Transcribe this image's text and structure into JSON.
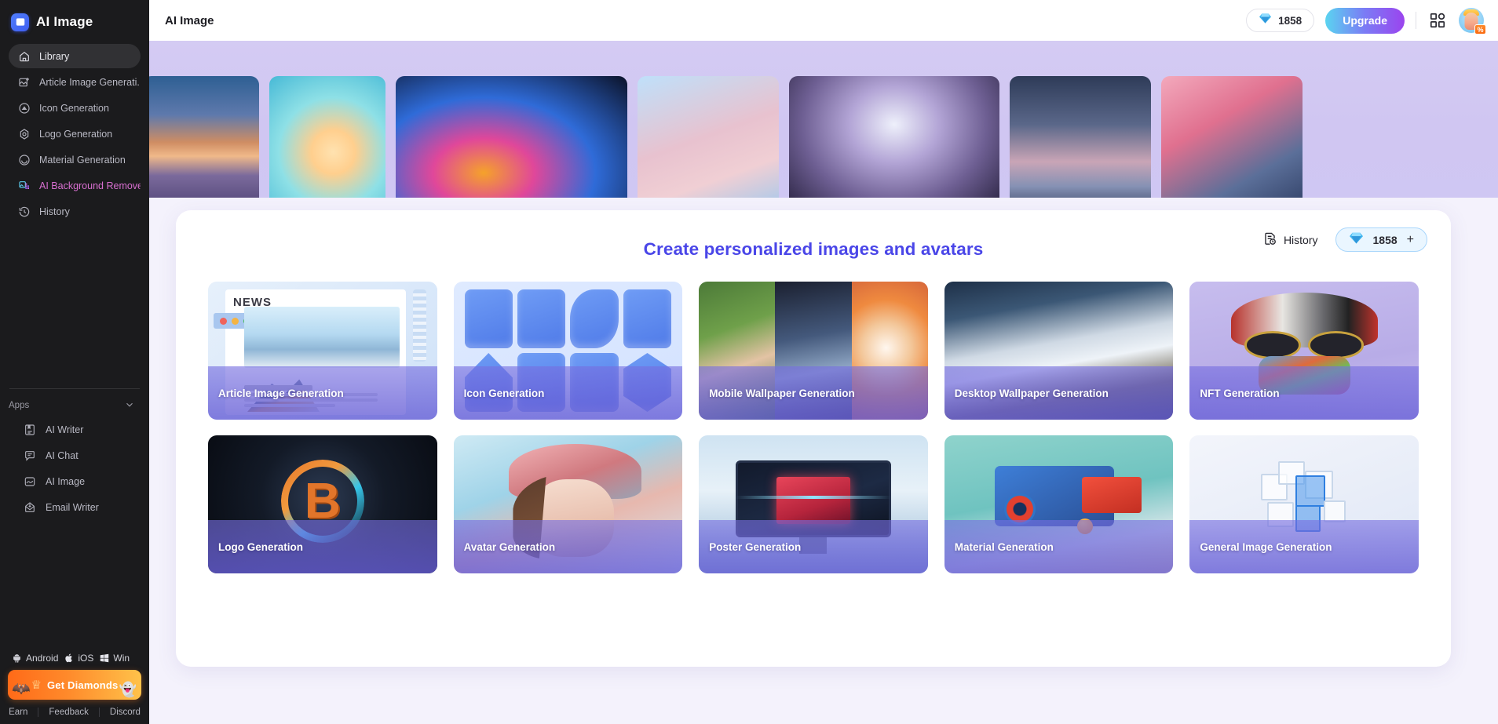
{
  "sidebar": {
    "brand": {
      "name": "AI Image",
      "logo_icon": "ai-image-logo-icon"
    },
    "items": [
      {
        "label": "Library",
        "icon": "home-icon",
        "active": true
      },
      {
        "label": "Article Image Generati...",
        "icon": "image-plus-icon",
        "active": false
      },
      {
        "label": "Icon Generation",
        "icon": "icon-generation-icon",
        "active": false
      },
      {
        "label": "Logo Generation",
        "icon": "logo-generation-icon",
        "active": false
      },
      {
        "label": "Material Generation",
        "icon": "material-generation-icon",
        "active": false
      },
      {
        "label": "AI Background Remove",
        "icon": "background-remove-icon",
        "active": false,
        "accent": true
      },
      {
        "label": "History",
        "icon": "history-clock-icon",
        "active": false
      }
    ],
    "apps_section": {
      "label": "Apps",
      "collapse_icon": "chevron-down-icon"
    },
    "apps": [
      {
        "label": "AI Writer",
        "icon": "ai-writer-icon"
      },
      {
        "label": "AI Chat",
        "icon": "ai-chat-icon"
      },
      {
        "label": "AI Image",
        "icon": "ai-image-icon"
      },
      {
        "label": "Email Writer",
        "icon": "email-writer-icon"
      }
    ],
    "platforms": [
      {
        "label": "Android",
        "icon": "android-icon"
      },
      {
        "label": "iOS",
        "icon": "apple-icon"
      },
      {
        "label": "Win",
        "icon": "windows-icon"
      }
    ],
    "get_diamonds": {
      "label": "Get Diamonds",
      "icon": "crown-icon",
      "left_icon": "bat-mascot-icon",
      "right_icon": "ghost-mascot-icon"
    },
    "footer_links": [
      "Earn",
      "Feedback",
      "Discord"
    ]
  },
  "topbar": {
    "title": "AI Image",
    "credits": {
      "value": "1858",
      "icon": "diamond-icon"
    },
    "upgrade_label": "Upgrade",
    "grid_icon": "apps-grid-icon",
    "avatar_icon": "user-avatar",
    "avatar_badge": "%"
  },
  "card": {
    "title": "Create personalized images and avatars",
    "history": {
      "label": "History",
      "icon": "history-file-icon"
    },
    "diamonds": {
      "value": "1858",
      "icon": "diamond-icon",
      "plus": "+"
    },
    "tiles": [
      {
        "label": "Article Image Generation",
        "art": "a-article"
      },
      {
        "label": "Icon Generation",
        "art": "a-icon"
      },
      {
        "label": "Mobile Wallpaper Generation",
        "art": "a-mobile"
      },
      {
        "label": "Desktop Wallpaper Generation",
        "art": "a-desktop"
      },
      {
        "label": "NFT Generation",
        "art": "a-nft"
      },
      {
        "label": "Logo Generation",
        "art": "a-logo"
      },
      {
        "label": "Avatar Generation",
        "art": "a-avatar"
      },
      {
        "label": "Poster Generation",
        "art": "a-poster"
      },
      {
        "label": "Material Generation",
        "art": "a-material"
      },
      {
        "label": "General Image Generation",
        "art": "a-general"
      }
    ],
    "article_tile_text": {
      "news": "NEWS"
    },
    "logo_tile_text": {
      "letter": "B"
    }
  },
  "banner": {
    "thumbnail_count": 7
  },
  "colors": {
    "sidebar_bg": "#1b1b1d",
    "accent_purple": "#4a46e8",
    "banner_purple": "#d0c6f2",
    "upgrade_gradient_start": "#5ad4f0",
    "upgrade_gradient_end": "#9b44ee",
    "background_remove_accent": "#d86fd0",
    "get_diamonds_gradient_start": "#ff6a18",
    "get_diamonds_gradient_end": "#ffc24a",
    "page_bg": "#f4f2fc"
  }
}
